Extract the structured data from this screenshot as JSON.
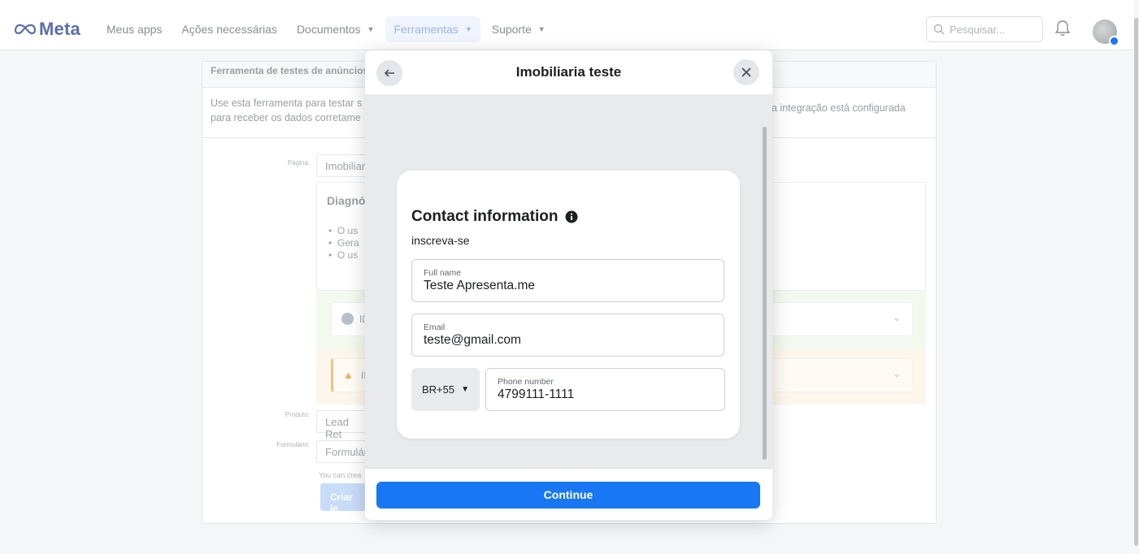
{
  "topbar": {
    "logo_text": "Meta",
    "nav": [
      {
        "label": "Meus apps"
      },
      {
        "label": "Ações necessárias"
      },
      {
        "label": "Documentos"
      },
      {
        "label": "Ferramentas"
      },
      {
        "label": "Suporte"
      }
    ],
    "search_placeholder": "Pesquisar..."
  },
  "background": {
    "card_title": "Ferramenta de testes de anúncios",
    "description_left_line1": "Use esta ferramenta para testar s",
    "description_left_line2": "para receber os dados corretame",
    "description_right": "a integração está configurada",
    "labels": {
      "pagina": "Página:",
      "produto": "Produto:",
      "formulario": "Formulário:"
    },
    "pagina_value": "Imobiliar",
    "produto_value": "Lead Ret",
    "formulario_value": "Formulár",
    "diag_title": "Diagnó",
    "diag_bullets": [
      "O us",
      "Gera",
      "O us"
    ],
    "row_ok_text": "ID",
    "row_warn_text": "ID",
    "note": "You can crea",
    "button_label": "Criar le"
  },
  "modal": {
    "title": "Imobiliaria teste",
    "section_title": "Contact information",
    "subtitle": "inscreva-se",
    "full_name": {
      "label": "Full name",
      "value": "Teste Apresenta.me"
    },
    "email": {
      "label": "Email",
      "value": "teste@gmail.com"
    },
    "country_code": "BR+55",
    "phone": {
      "label": "Phone number",
      "value": "4799111-1111"
    },
    "continue_label": "Continue"
  },
  "colors": {
    "primary": "#1877f2",
    "meta_logo": "#5b6fa8"
  }
}
